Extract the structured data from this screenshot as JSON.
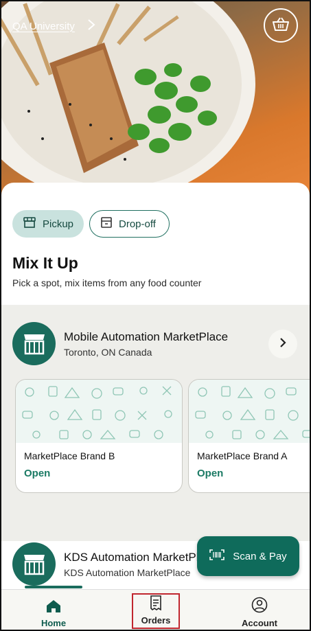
{
  "header": {
    "location": "QA University",
    "cart_icon": "basket-icon"
  },
  "fulfillment": {
    "pickup_label": "Pickup",
    "dropoff_label": "Drop-off",
    "selected": "Pickup"
  },
  "section": {
    "title": "Mix It Up",
    "subtitle": "Pick a spot, mix items from any food counter"
  },
  "marketplaces": [
    {
      "name": "Mobile Automation MarketPlace",
      "location": "Toronto, ON Canada",
      "brands": [
        {
          "name": "MarketPlace Brand B",
          "status": "Open"
        },
        {
          "name": "MarketPlace Brand A",
          "status": "Open"
        }
      ]
    },
    {
      "name": "KDS Automation MarketPlace",
      "location": "KDS Automation MarketPlace"
    }
  ],
  "fab": {
    "label": "Scan & Pay"
  },
  "nav": {
    "items": [
      {
        "label": "Home",
        "icon": "home-icon"
      },
      {
        "label": "Orders",
        "icon": "receipt-icon"
      },
      {
        "label": "Account",
        "icon": "account-icon"
      }
    ]
  },
  "colors": {
    "brand": "#1a6c5d",
    "accent_light": "#c9e2de",
    "open_status": "#1b7a64"
  }
}
